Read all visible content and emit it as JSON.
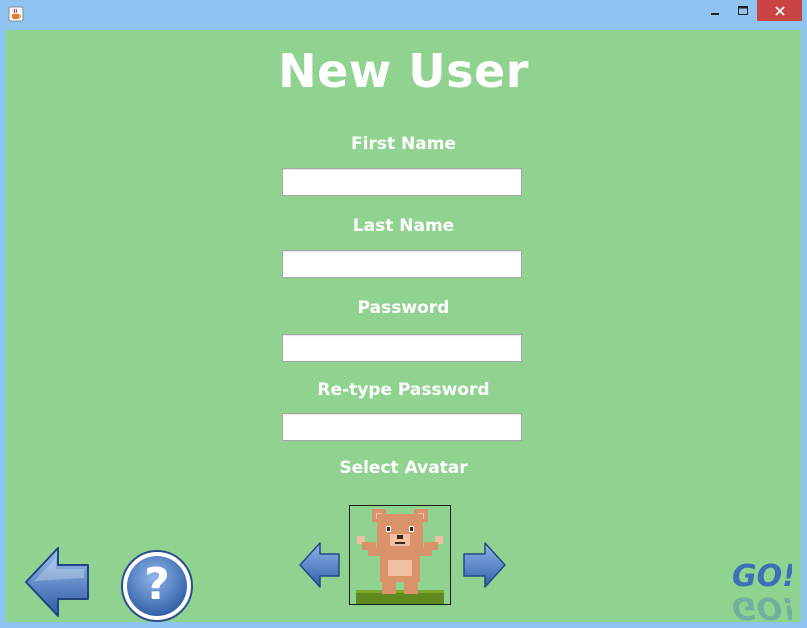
{
  "window": {
    "icon": "java-cup-icon",
    "controls": [
      "minimize-icon",
      "maximize-icon",
      "close-icon"
    ]
  },
  "heading": "New User",
  "form": {
    "first_name_label": "First Name",
    "first_name_value": "",
    "last_name_label": "Last Name",
    "last_name_value": "",
    "password_label": "Password",
    "password_value": "",
    "retype_password_label": "Re-type Password",
    "retype_password_value": ""
  },
  "avatar": {
    "label": "Select Avatar",
    "current": "bear-avatar",
    "prev_icon": "arrow-left-icon",
    "next_icon": "arrow-right-icon"
  },
  "footer": {
    "back_icon": "arrow-left-icon",
    "help_icon": "question-mark-icon",
    "help_glyph": "?",
    "go_label": "GO!"
  },
  "colors": {
    "background": "#90d290",
    "title_bar": "#8ec4ef",
    "close_button": "#c94343",
    "arrow_blue": "#3d6fb8",
    "bear": "#d9926a"
  }
}
